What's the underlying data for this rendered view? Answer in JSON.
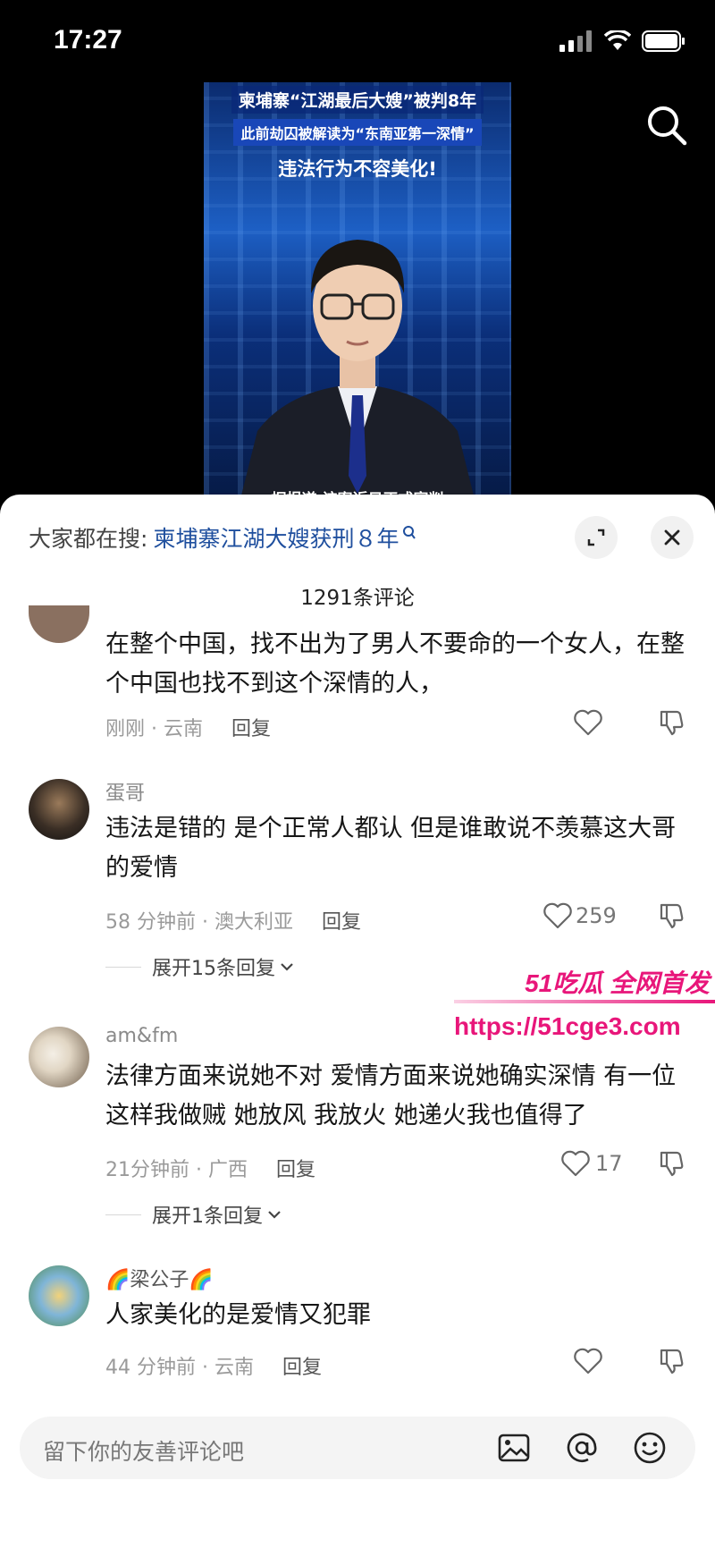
{
  "status_bar": {
    "time": "17:27"
  },
  "video": {
    "headline_1": "柬埔寨“江湖最后大嫂”被判8年",
    "headline_2": "此前劫囚被解读为“东南亚第一深情”",
    "headline_3": "违法行为不容美化!",
    "subtitle": "据报道 该案近日正式宣判"
  },
  "panel": {
    "hot_search_label": "大家都在搜:",
    "hot_search_keyword": "柬埔寨江湖大嫂获刑８年",
    "comment_count": "1291条评论"
  },
  "comments": [
    {
      "author": "",
      "text": "在整个中国，找不出为了男人不要命的一个女人，在整个中国也找不到这个深情的人，",
      "time_location": "刚刚 · 云南",
      "reply_label": "回复",
      "likes": ""
    },
    {
      "author": "蛋哥",
      "text": "违法是错的 是个正常人都认 但是谁敢说不羡慕这大哥的爱情",
      "time_location": "58 分钟前 · 澳大利亚",
      "reply_label": "回复",
      "likes": "259",
      "expand_label": "展开15条回复"
    },
    {
      "author": "am&fm",
      "text": "法律方面来说她不对 爱情方面来说她确实深情 有一位这样我做贼 她放风 我放火 她递火我也值得了",
      "time_location": "21分钟前 · 广西",
      "reply_label": "回复",
      "likes": "17",
      "expand_label": "展开1条回复"
    },
    {
      "author": "🌈梁公子🌈",
      "text": "人家美化的是爱情又犯罪",
      "time_location": "44 分钟前 · 云南",
      "reply_label": "回复",
      "likes": ""
    }
  ],
  "watermark": {
    "brand": "51吃瓜 全网首发",
    "url": "https://51cge3.com"
  },
  "input": {
    "placeholder": "留下你的友善评论吧"
  },
  "colors": {
    "keyword": "#1f4f9e",
    "watermark": "#e8167a"
  }
}
